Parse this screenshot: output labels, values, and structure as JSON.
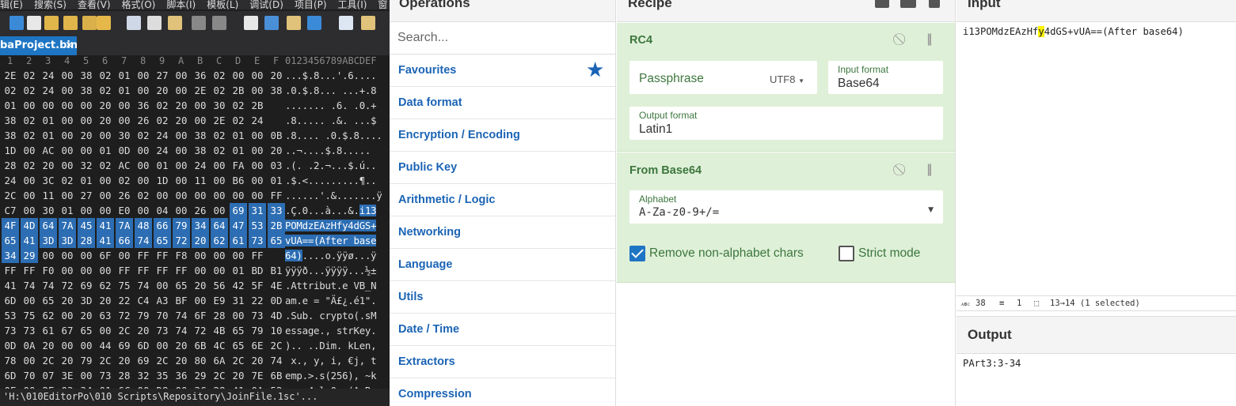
{
  "hex_editor": {
    "menu": [
      "辑(E)",
      "搜索(S)",
      "查看(V)",
      "格式(O)",
      "脚本(I)",
      "模板(L)",
      "调试(D)",
      "项目(P)",
      "工具(I)",
      "窗"
    ],
    "tab_label": "baProject.bin",
    "tab_close": "×",
    "column_header": [
      "1",
      "2",
      "3",
      "4",
      "5",
      "6",
      "7",
      "8",
      "9",
      "A",
      "B",
      "C",
      "D",
      "E",
      "F"
    ],
    "ascii_header": "0123456789ABCDEF",
    "rows": [
      {
        "hex": [
          "2E",
          "02",
          "24",
          "00",
          "38",
          "02",
          "01",
          "00",
          "27",
          "00",
          "36",
          "02",
          "00",
          "00",
          "20"
        ],
        "ascii": "...$.8...'.6...."
      },
      {
        "hex": [
          "02",
          "02",
          "24",
          "00",
          "38",
          "02",
          "01",
          "00",
          "20",
          "00",
          "2E",
          "02",
          "2B",
          "00",
          "38"
        ],
        "ascii": ".0.$.8... ...+.8"
      },
      {
        "hex": [
          "01",
          "00",
          "00",
          "00",
          "00",
          "20",
          "00",
          "36",
          "02",
          "20",
          "00",
          "30",
          "02",
          "2B"
        ],
        "ascii": "....... .6. .0.+"
      },
      {
        "hex": [
          "38",
          "02",
          "01",
          "00",
          "00",
          "20",
          "00",
          "26",
          "02",
          "20",
          "00",
          "2E",
          "02",
          "24"
        ],
        "ascii": ".8..... .&. ...$"
      },
      {
        "hex": [
          "38",
          "02",
          "01",
          "00",
          "20",
          "00",
          "30",
          "02",
          "24",
          "00",
          "38",
          "02",
          "01",
          "00",
          "0B"
        ],
        "ascii": ".8.... .0.$.8...."
      },
      {
        "hex": [
          "1D",
          "00",
          "AC",
          "00",
          "00",
          "01",
          "0D",
          "00",
          "24",
          "00",
          "38",
          "02",
          "01",
          "00",
          "20"
        ],
        "ascii": "..¬....$.8..... "
      },
      {
        "hex": [
          "28",
          "02",
          "20",
          "00",
          "32",
          "02",
          "AC",
          "00",
          "01",
          "00",
          "24",
          "00",
          "FA",
          "00",
          "03"
        ],
        "ascii": ".(. .2.¬...$.ú.."
      },
      {
        "hex": [
          "24",
          "00",
          "3C",
          "02",
          "01",
          "00",
          "02",
          "00",
          "1D",
          "00",
          "11",
          "00",
          "B6",
          "00",
          "01"
        ],
        "ascii": ".$.<.........¶.."
      },
      {
        "hex": [
          "2C",
          "00",
          "11",
          "00",
          "27",
          "00",
          "26",
          "02",
          "00",
          "00",
          "00",
          "00",
          "00",
          "00",
          "FF"
        ],
        "ascii": "......'.&.......ÿ"
      },
      {
        "hex": [
          "C7",
          "00",
          "30",
          "01",
          "00",
          "00",
          "E0",
          "00",
          "04",
          "00",
          "26",
          "00",
          "69",
          "31",
          "33"
        ],
        "ascii": ".Ç.0...à...&.i13",
        "sel_from_hex": 12,
        "sel_from_asc": 13
      },
      {
        "hex": [
          "4F",
          "4D",
          "64",
          "7A",
          "45",
          "41",
          "7A",
          "48",
          "66",
          "79",
          "34",
          "64",
          "47",
          "53",
          "2B"
        ],
        "ascii": "POMdzEAzHfy4dGS+",
        "sel_all": true
      },
      {
        "hex": [
          "65",
          "41",
          "3D",
          "3D",
          "28",
          "41",
          "66",
          "74",
          "65",
          "72",
          "20",
          "62",
          "61",
          "73",
          "65"
        ],
        "ascii": "vUA==(After base",
        "sel_all": true
      },
      {
        "hex": [
          "34",
          "29",
          "00",
          "00",
          "00",
          "6F",
          "00",
          "FF",
          "FF",
          "F8",
          "00",
          "00",
          "00",
          "FF"
        ],
        "ascii": "64)....o.ÿÿø...ÿ",
        "sel_to_hex": 2,
        "sel_to_asc": 3
      },
      {
        "hex": [
          "FF",
          "FF",
          "F0",
          "00",
          "00",
          "00",
          "FF",
          "FF",
          "FF",
          "FF",
          "00",
          "00",
          "01",
          "BD",
          "B1"
        ],
        "ascii": "ÿÿÿð...ÿÿÿÿ...½±"
      },
      {
        "hex": [
          "41",
          "74",
          "74",
          "72",
          "69",
          "62",
          "75",
          "74",
          "00",
          "65",
          "20",
          "56",
          "42",
          "5F",
          "4E"
        ],
        "ascii": ".Attribut.e VB_N"
      },
      {
        "hex": [
          "6D",
          "00",
          "65",
          "20",
          "3D",
          "20",
          "22",
          "C4",
          "A3",
          "BF",
          "00",
          "E9",
          "31",
          "22",
          "0D"
        ],
        "ascii": "am.e = \"Ä£¿.é1\"."
      },
      {
        "hex": [
          "53",
          "75",
          "62",
          "00",
          "20",
          "63",
          "72",
          "79",
          "70",
          "74",
          "6F",
          "28",
          "00",
          "73",
          "4D"
        ],
        "ascii": ".Sub. crypto(.sM"
      },
      {
        "hex": [
          "73",
          "73",
          "61",
          "67",
          "65",
          "00",
          "2C",
          "20",
          "73",
          "74",
          "72",
          "4B",
          "65",
          "79",
          "10"
        ],
        "ascii": "essage., strKey."
      },
      {
        "hex": [
          "0D",
          "0A",
          "20",
          "00",
          "00",
          "44",
          "69",
          "6D",
          "00",
          "20",
          "6B",
          "4C",
          "65",
          "6E",
          "2C"
        ],
        "ascii": ").. ..Dim. kLen,"
      },
      {
        "hex": [
          "78",
          "00",
          "2C",
          "20",
          "79",
          "2C",
          "20",
          "69",
          "2C",
          "20",
          "80",
          "6A",
          "2C",
          "20",
          "74"
        ],
        "ascii": " x., y, i, €j, t"
      },
      {
        "hex": [
          "6D",
          "70",
          "07",
          "3E",
          "00",
          "73",
          "28",
          "32",
          "35",
          "36",
          "29",
          "2C",
          "20",
          "7E",
          "6B"
        ],
        "ascii": "emp.>.s(256), ~k"
      },
      {
        "hex": [
          "0E",
          "00",
          "2E",
          "03",
          "34",
          "01",
          "6C",
          "00",
          "D8",
          "00",
          "3C",
          "28",
          "41",
          "0A",
          "52"
        ],
        "ascii": "....4.l.0.<(A.R"
      }
    ],
    "status": " 'H:\\010EditorPo\\010 Scripts\\Repository\\JoinFile.1sc'..."
  },
  "operations": {
    "title": "Operations",
    "search_placeholder": "Search...",
    "categories": [
      "Favourites",
      "Data format",
      "Encryption / Encoding",
      "Public Key",
      "Arithmetic / Logic",
      "Networking",
      "Language",
      "Utils",
      "Date / Time",
      "Extractors",
      "Compression"
    ],
    "favourites_icon": "★"
  },
  "recipe": {
    "title": "Recipe",
    "rc4": {
      "title": "RC4",
      "passphrase_placeholder": "Passphrase",
      "passphrase_encoding": "UTF8",
      "input_format_label": "Input format",
      "input_format_value": "Base64",
      "output_format_label": "Output format",
      "output_format_value": "Latin1"
    },
    "from_base64": {
      "title": "From Base64",
      "alphabet_label": "Alphabet",
      "alphabet_value": "A-Za-z0-9+/=",
      "remove_non_alphabet_label": "Remove non-alphabet chars",
      "remove_non_alphabet_checked": true,
      "strict_mode_label": "Strict mode",
      "strict_mode_checked": false
    }
  },
  "input": {
    "title": "Input",
    "text_before": "i13POMdzEAzHf",
    "text_cursor": "y",
    "text_after": "4dGS+vUA==(After base64)",
    "status_length": "38",
    "status_lines": "1",
    "status_selection": "13→14 (1 selected)"
  },
  "output": {
    "title": "Output",
    "text": "PArt3:3-34"
  }
}
